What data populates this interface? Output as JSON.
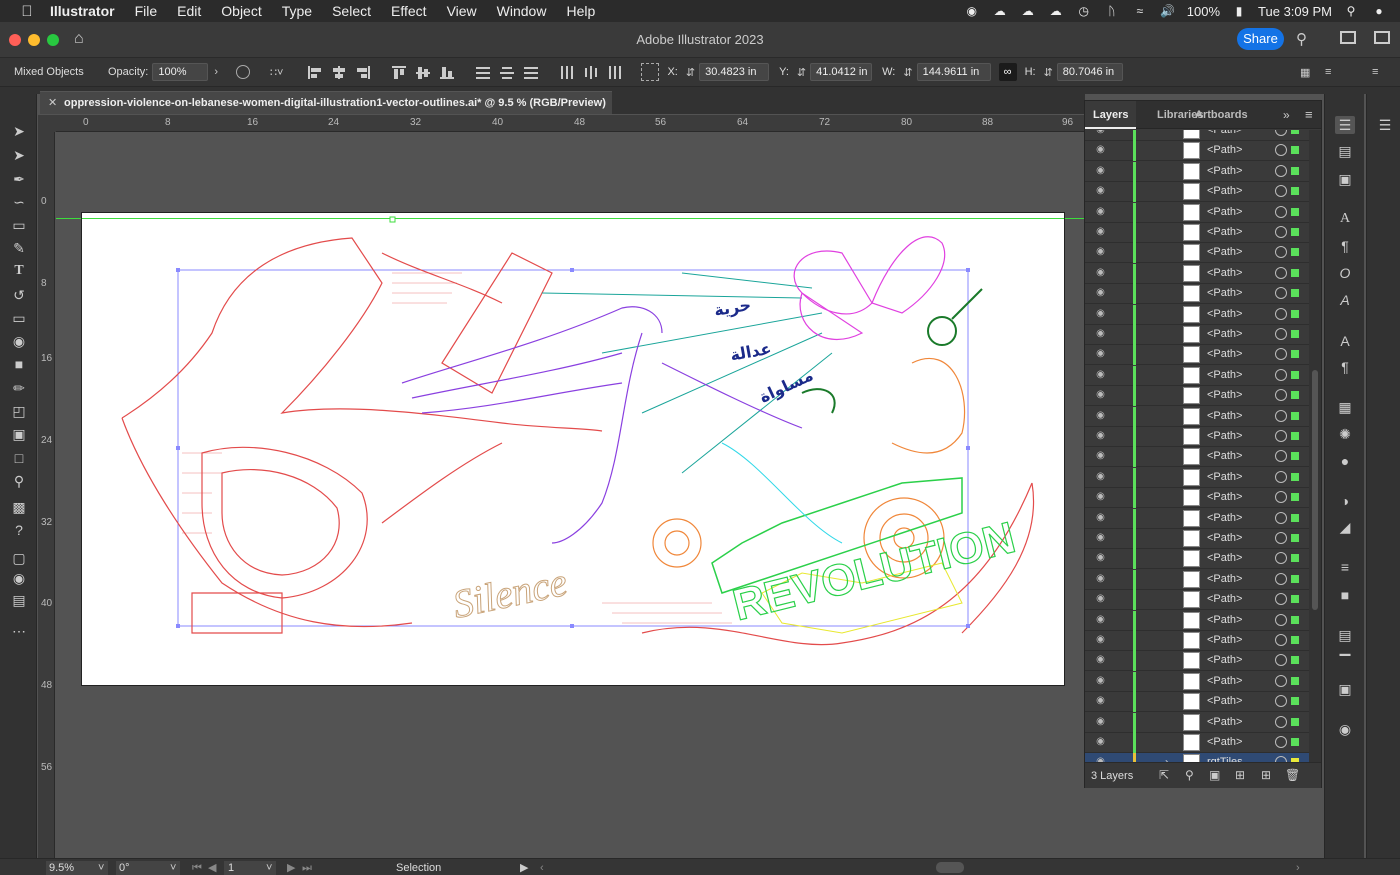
{
  "menubar": {
    "app": "Illustrator",
    "items": [
      "File",
      "Edit",
      "Object",
      "Type",
      "Select",
      "Effect",
      "View",
      "Window",
      "Help"
    ],
    "battery": "100%",
    "clock": "Tue 3:09 PM"
  },
  "window": {
    "title": "Adobe Illustrator 2023",
    "share": "Share"
  },
  "control": {
    "selection": "Mixed Objects",
    "opacity_label": "Opacity:",
    "opacity": "100%",
    "x_label": "X:",
    "x": "30.4823 in",
    "y_label": "Y:",
    "y": "41.0412 in",
    "w_label": "W:",
    "w": "144.9611 in",
    "h_label": "H:",
    "h": "80.7046 in"
  },
  "document": {
    "tab": "oppression-violence-on-lebanese-women-digital-illustration1-vector-outlines.ai* @ 9.5 % (RGB/Preview)"
  },
  "ruler": {
    "h": [
      "0",
      "8",
      "16",
      "24",
      "32",
      "40",
      "48",
      "56",
      "64",
      "72",
      "80",
      "88",
      "96"
    ],
    "v": [
      "0",
      "8",
      "16",
      "24",
      "32",
      "40",
      "48",
      "56"
    ]
  },
  "artwork": {
    "words": [
      "Silence",
      "REVOLUTION"
    ],
    "arabic": [
      "حرية",
      "عدالة",
      "مساواة"
    ]
  },
  "layers": {
    "tabs": [
      "Layers",
      "Libraries",
      "Artboards"
    ],
    "path_label": "<Path>",
    "path_count": 31,
    "group": "rgtTiles",
    "footer": "3 Layers"
  },
  "status": {
    "zoom": "9.5%",
    "angle": "0°",
    "artboard": "1",
    "tool": "Selection"
  },
  "colors": {
    "accent": "#1473e6",
    "layer_green": "#5be05b",
    "guide_green": "#3cdd3c"
  }
}
